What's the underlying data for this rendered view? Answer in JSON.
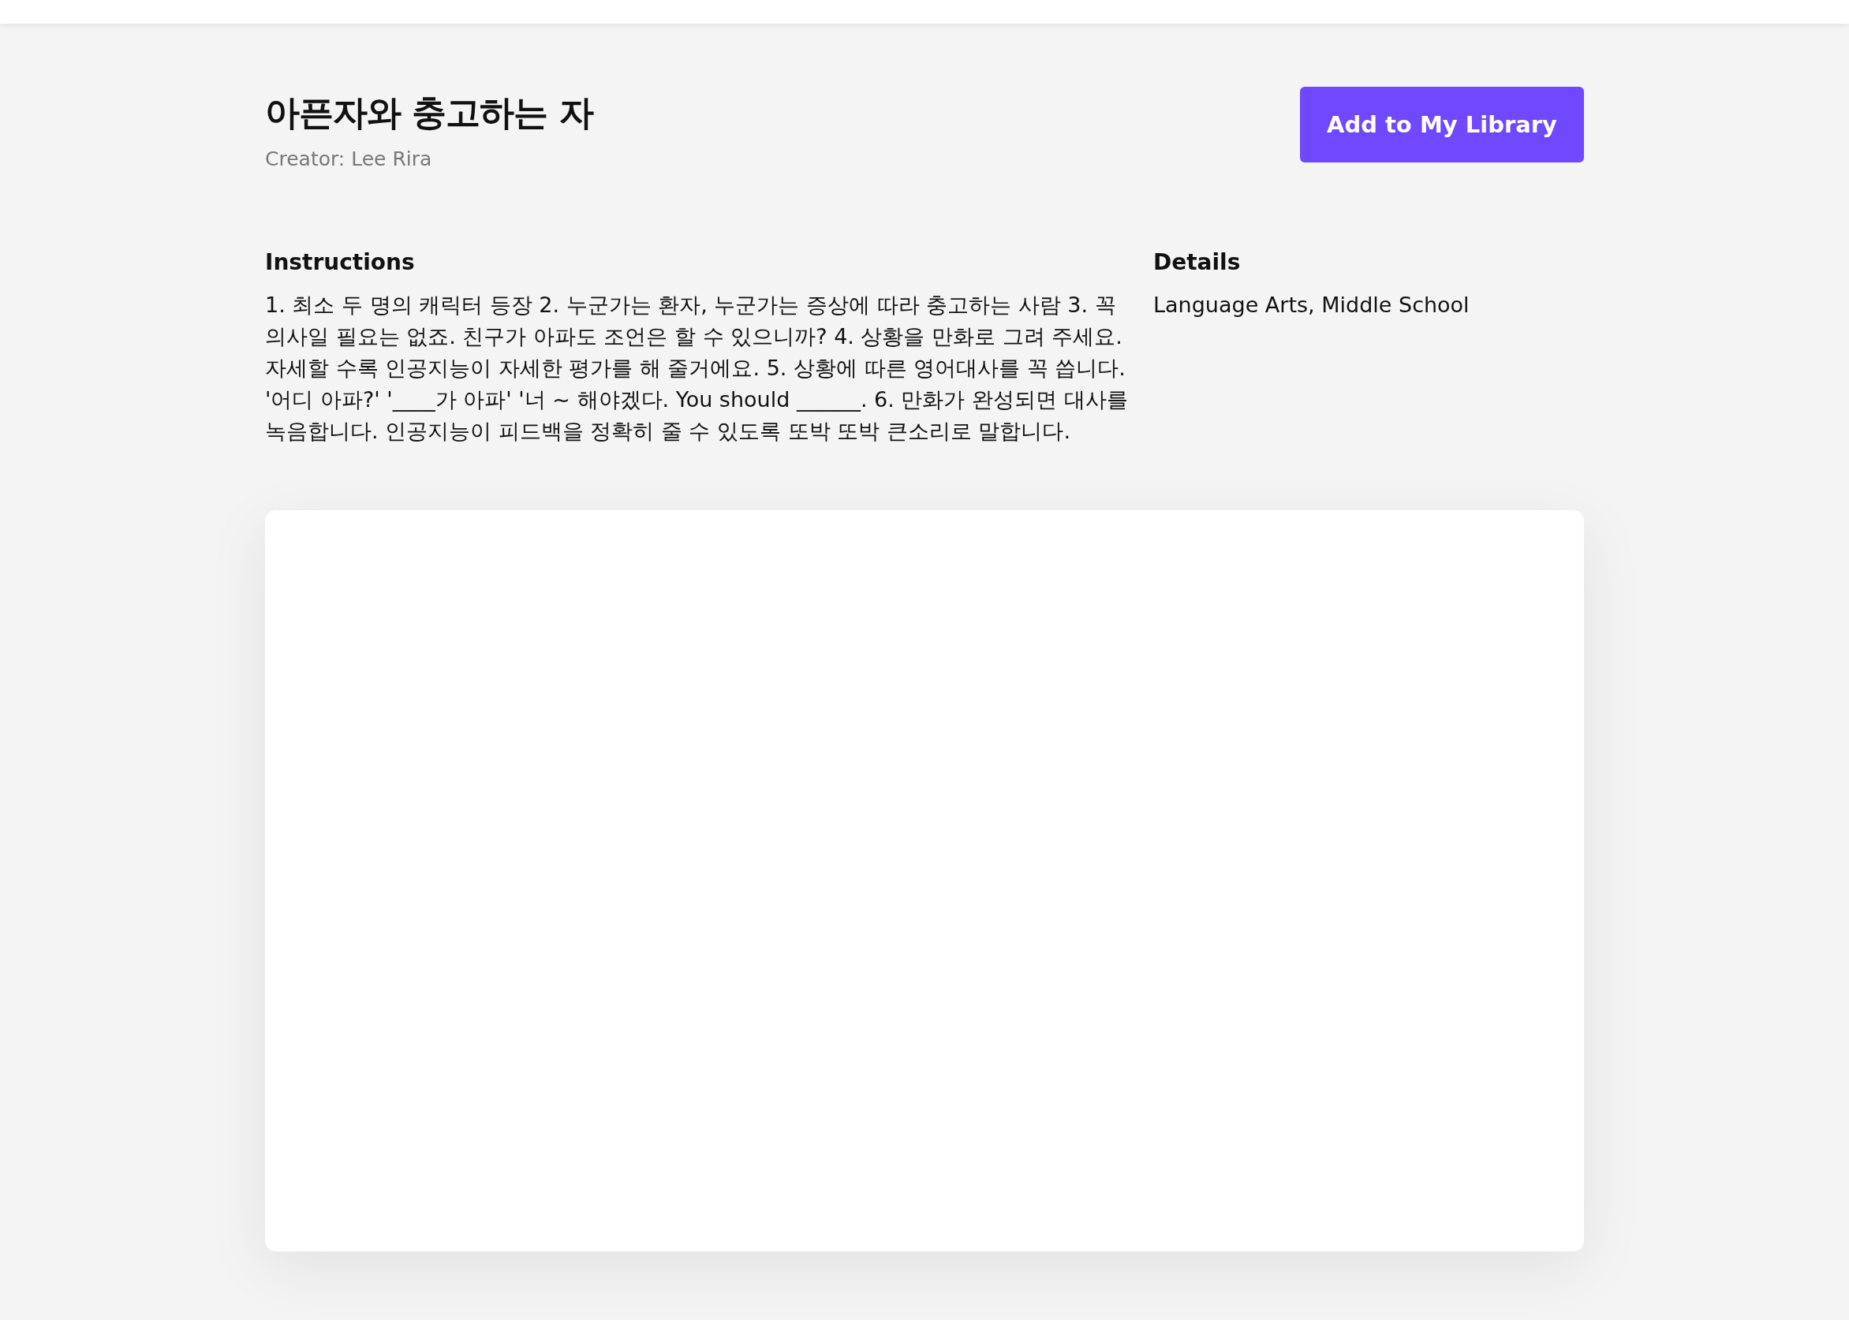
{
  "header": {
    "title": "아픈자와 충고하는 자",
    "creator": "Creator: Lee Rira",
    "add_button": "Add to My Library"
  },
  "instructions": {
    "heading": "Instructions",
    "text": "1. 최소 두 명의 캐릭터 등장 2. 누군가는 환자, 누군가는 증상에 따라 충고하는 사람 3. 꼭 의사일 필요는 없죠. 친구가 아파도 조언은 할 수 있으니까? 4. 상황을 만화로 그려 주세요. 자세할 수록 인공지능이 자세한 평가를 해 줄거에요. 5. 상황에 따른 영어대사를 꼭 씁니다. '어디 아파?' '____가 아파' '너 ~ 해야겠다. You should ______. 6. 만화가 완성되면 대사를 녹음합니다. 인공지능이 피드백을 정확히 줄 수 있도록 또박 또박 큰소리로 말합니다."
  },
  "details": {
    "heading": "Details",
    "text": "Language Arts, Middle School"
  }
}
